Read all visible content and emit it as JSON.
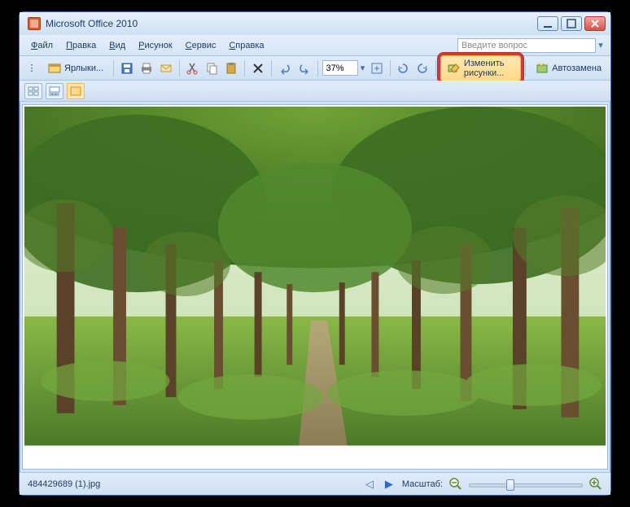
{
  "window": {
    "title": "Microsoft Office 2010"
  },
  "menu": {
    "file": "Файл",
    "edit": "Правка",
    "view": "Вид",
    "picture": "Рисунок",
    "tools": "Сервис",
    "help": "Справка"
  },
  "searchBox": {
    "placeholder": "Введите вопрос"
  },
  "toolbar": {
    "shortcuts": "Ярлыки...",
    "zoom_value": "37%",
    "edit_pictures": "Изменить рисунки...",
    "autocorrect": "Автозамена"
  },
  "statusbar": {
    "filename": "484429689 (1).jpg",
    "zoom_label": "Масштаб:"
  }
}
